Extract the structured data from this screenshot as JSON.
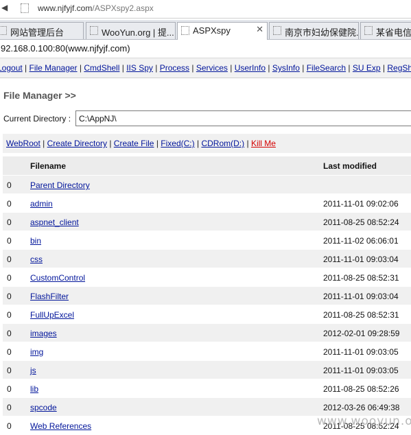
{
  "browser": {
    "url_domain": "www.njfyjf.com",
    "url_path": "/ASPXspy2.aspx",
    "back_glyph": "◀",
    "tabs": [
      {
        "label": "网站管理后台"
      },
      {
        "label": "WooYun.org | 提..."
      },
      {
        "label": "ASPXspy",
        "close": "✕"
      },
      {
        "label": "南京市妇幼保健院..."
      },
      {
        "label": "某省电信线"
      }
    ]
  },
  "host_line": "92.168.0.100:80(www.njfyjf.com)",
  "top_menu": {
    "items": [
      "Logout",
      "File Manager",
      "CmdShell",
      "IIS Spy",
      "Process",
      "Services",
      "UserInfo",
      "SysInfo",
      "FileSearch",
      "SU Exp",
      "RegShell"
    ],
    "sep": "|"
  },
  "file_manager": {
    "title": "File Manager >>",
    "current_directory_label": "Current Directory :",
    "current_directory_value": "C:\\AppNJ\\",
    "actions": [
      "WebRoot",
      "Create Directory",
      "Create File",
      "Fixed(C:)",
      "CDRom(D:)",
      "Kill Me"
    ],
    "columns": {
      "filename": "Filename",
      "last_modified": "Last modified"
    },
    "rows": [
      {
        "n": "0",
        "name": "Parent Directory",
        "modified": ""
      },
      {
        "n": "0",
        "name": "admin",
        "modified": "2011-11-01 09:02:06"
      },
      {
        "n": "0",
        "name": "aspnet_client",
        "modified": "2011-08-25 08:52:24"
      },
      {
        "n": "0",
        "name": "bin",
        "modified": "2011-11-02 06:06:01"
      },
      {
        "n": "0",
        "name": "css",
        "modified": "2011-11-01 09:03:04"
      },
      {
        "n": "0",
        "name": "CustomControl",
        "modified": "2011-08-25 08:52:31"
      },
      {
        "n": "0",
        "name": "FlashFilter",
        "modified": "2011-11-01 09:03:04"
      },
      {
        "n": "0",
        "name": "FullUpExcel",
        "modified": "2011-08-25 08:52:31"
      },
      {
        "n": "0",
        "name": "images",
        "modified": "2012-02-01 09:28:59"
      },
      {
        "n": "0",
        "name": "img",
        "modified": "2011-11-01 09:03:05"
      },
      {
        "n": "0",
        "name": "js",
        "modified": "2011-11-01 09:03:05"
      },
      {
        "n": "0",
        "name": "lib",
        "modified": "2011-08-25 08:52:26"
      },
      {
        "n": "0",
        "name": "spcode",
        "modified": "2012-03-26 06:49:38"
      },
      {
        "n": "0",
        "name": "Web References",
        "modified": "2011-08-25 08:52:24"
      }
    ]
  },
  "watermark": "www.wooyun.org",
  "colors": {
    "link": "#00149a",
    "kill_link": "#d40000",
    "row_shade": "#f0f0f0"
  }
}
